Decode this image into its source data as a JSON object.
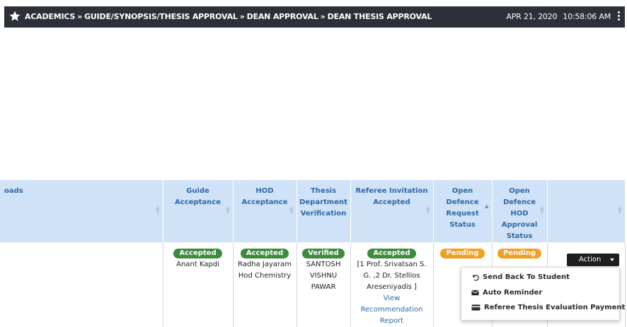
{
  "topbar": {
    "breadcrumbs": [
      "ACADEMICS",
      "GUIDE/SYNOPSIS/THESIS APPROVAL",
      "DEAN APPROVAL",
      "DEAN THESIS APPROVAL"
    ],
    "separator": "»",
    "date": "APR 21, 2020",
    "time": "10:58:06 AM"
  },
  "table": {
    "headers": [
      "oads",
      "Guide Acceptance",
      "HOD Acceptance",
      "Thesis Department Verification",
      "Referee Invitation Accepted",
      "Open Defence Request Status",
      "Open Defence HOD Approval Status",
      ""
    ],
    "row": {
      "guide_status": "Accepted",
      "guide_name": "Anant Kapdi",
      "hod_status": "Accepted",
      "hod_name": "Radha Jayaram Hod Chemistry",
      "verification_status": "Verified",
      "verifier_name": "SANTOSH VISHNU PAWAR",
      "referee_status": "Accepted",
      "referee_names": "[1 Prof. Srivatsan S. G. ,2 Dr. Stellios Areseniyadis ]",
      "referee_link": "View Recommendation Report",
      "defence_request_status": "Pending",
      "defence_hod_status": "Pending"
    }
  },
  "action": {
    "label": "Action",
    "menu": [
      "Send Back To Student",
      "Auto Reminder",
      "Referee Thesis Evaluation Payment"
    ]
  },
  "colors": {
    "topbar_bg": "#2d3039",
    "header_bg": "#cfe2f7",
    "header_text": "#2e6aa8",
    "badge_green": "#3d8b3d",
    "badge_orange": "#f0a020"
  }
}
